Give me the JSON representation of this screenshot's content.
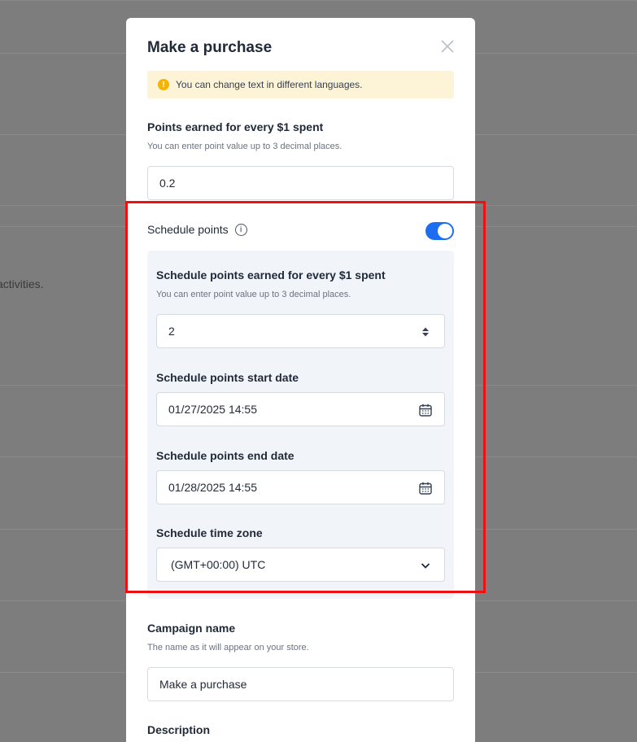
{
  "background": {
    "partial_text": "activities."
  },
  "modal": {
    "title": "Make a purchase",
    "close_icon": "close-icon",
    "notice": {
      "icon": "warning-circle-icon",
      "text": "You can change text in different languages."
    },
    "points_earned": {
      "label": "Points earned for every $1 spent",
      "help": "You can enter point value up to 3 decimal places.",
      "value": "0.2"
    },
    "schedule_points": {
      "label": "Schedule points",
      "info_icon": "info-icon",
      "enabled": true,
      "earned": {
        "label": "Schedule points earned for every $1 spent",
        "help": "You can enter point value up to 3 decimal places.",
        "value": "2"
      },
      "start_date": {
        "label": "Schedule points start date",
        "value": "01/27/2025 14:55"
      },
      "end_date": {
        "label": "Schedule points end date",
        "value": "01/28/2025 14:55"
      },
      "time_zone": {
        "label": "Schedule time zone",
        "value": "(GMT+00:00) UTC"
      }
    },
    "campaign_name": {
      "label": "Campaign name",
      "help": "The name as it will appear on your store.",
      "value": "Make a purchase"
    },
    "description": {
      "label": "Description"
    }
  },
  "colors": {
    "accent": "#1c6df2",
    "highlight": "#ee1111",
    "notice_bg": "#fdf3d6",
    "overlay": "#7d7d7d"
  }
}
